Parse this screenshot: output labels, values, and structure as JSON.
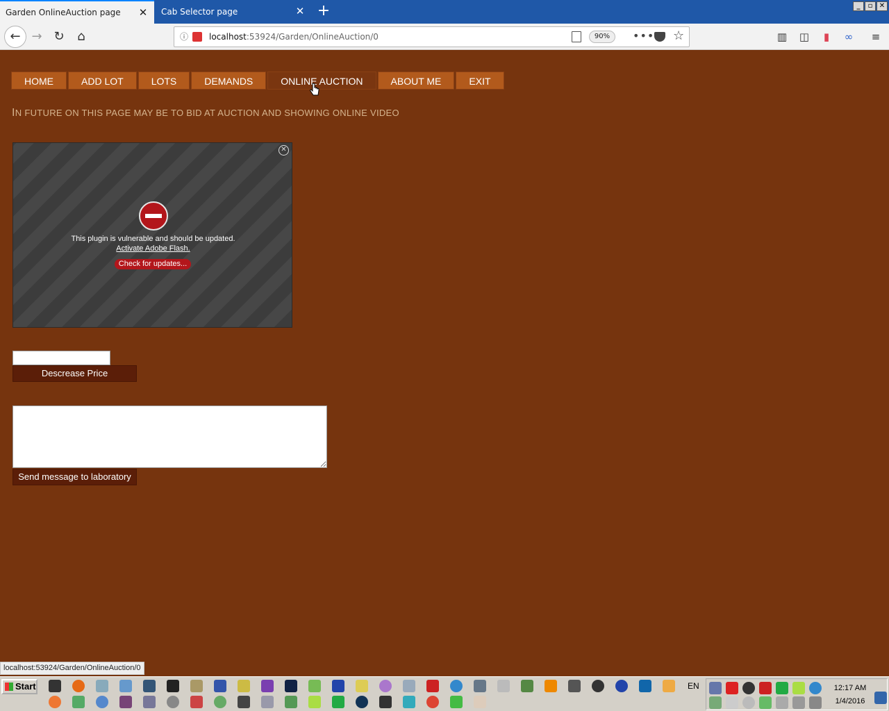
{
  "browser": {
    "tabs": [
      {
        "title": "Garden OnlineAuction page",
        "active": true
      },
      {
        "title": "Cab Selector page",
        "active": false
      }
    ],
    "url_host": "localhost",
    "url_path": ":53924/Garden/OnlineAuction/0",
    "zoom": "90%"
  },
  "menu": {
    "items": [
      "HOME",
      "ADD LOT",
      "LOTS",
      "DEMANDS",
      "ONLINE AUCTION",
      "ABOUT ME",
      "EXIT"
    ],
    "current": "ONLINE AUCTION"
  },
  "headline": {
    "first_letter": "I",
    "rest": "N FUTURE ON THIS PAGE MAY BE TO BID AT AUCTION AND SHOWING ONLINE VIDEO"
  },
  "plugin": {
    "message": "This plugin is vulnerable and should be updated.",
    "activate_link": "Activate Adobe Flash.",
    "check_button": "Check for updates..."
  },
  "form": {
    "price_value": "",
    "decrease_button": "Descrease Price",
    "message_value": "",
    "send_button": "Send message to laboratory"
  },
  "status_bar": "localhost:53924/Garden/OnlineAuction/0",
  "taskbar": {
    "start": "Start",
    "language": "EN",
    "time": "12:17 AM",
    "date": "1/4/2016"
  },
  "colors": {
    "page_bg": "#76340e",
    "menu_bg": "#b25a1c",
    "button_dark": "#5b1e08",
    "headline": "#d6b48e",
    "plugin_red": "#b3161b"
  }
}
